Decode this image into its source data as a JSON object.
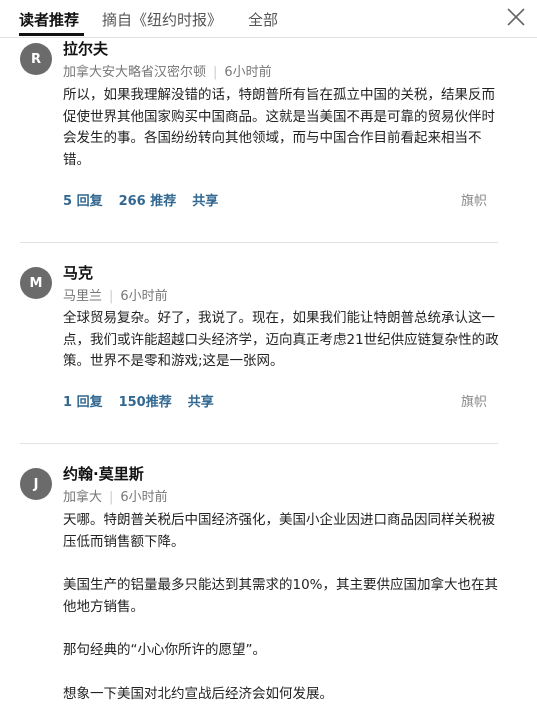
{
  "tabs": [
    {
      "label": "读者推荐"
    },
    {
      "label": "摘自《纽约时报》"
    },
    {
      "label": "全部"
    }
  ],
  "comments": [
    {
      "initial": "R",
      "name": "拉尔夫",
      "location": "加拿大安大略省汉密尔顿",
      "time": "6小时前",
      "paragraphs": [
        "所以，如果我理解没错的话，特朗普所有旨在孤立中国的关税，结果反而促使世界其他国家购买中国商品。这就是当美国不再是可靠的贸易伙伴时会发生的事。各国纷纷转向其他领域，而与中国合作目前看起来相当不错。"
      ],
      "replies": "5 回复",
      "recommend": "266 推荐",
      "share": "共享",
      "flag": "旗帜"
    },
    {
      "initial": "M",
      "name": "马克",
      "location": "马里兰",
      "time": "6小时前",
      "paragraphs": [
        "全球贸易复杂。好了，我说了。现在，如果我们能让特朗普总统承认这一点，我们或许能超越口头经济学，迈向真正考虑21世纪供应链复杂性的政策。世界不是零和游戏;这是一张网。"
      ],
      "replies": "1 回复",
      "recommend": "150推荐",
      "share": "共享",
      "flag": "旗帜"
    },
    {
      "initial": "J",
      "name": "约翰·莫里斯",
      "location": "加拿大",
      "time": "6小时前",
      "paragraphs": [
        "天哪。特朗普关税后中国经济强化，美国小企业因进口商品因同样关税被压低而销售额下降。",
        "美国生产的铝量最多只能达到其需求的10%，其主要供应国加拿大也在其他地方销售。",
        "那句经典的“小心你所许的愿望”。",
        "想象一下美国对北约宣战后经济会如何发展。"
      ]
    }
  ]
}
